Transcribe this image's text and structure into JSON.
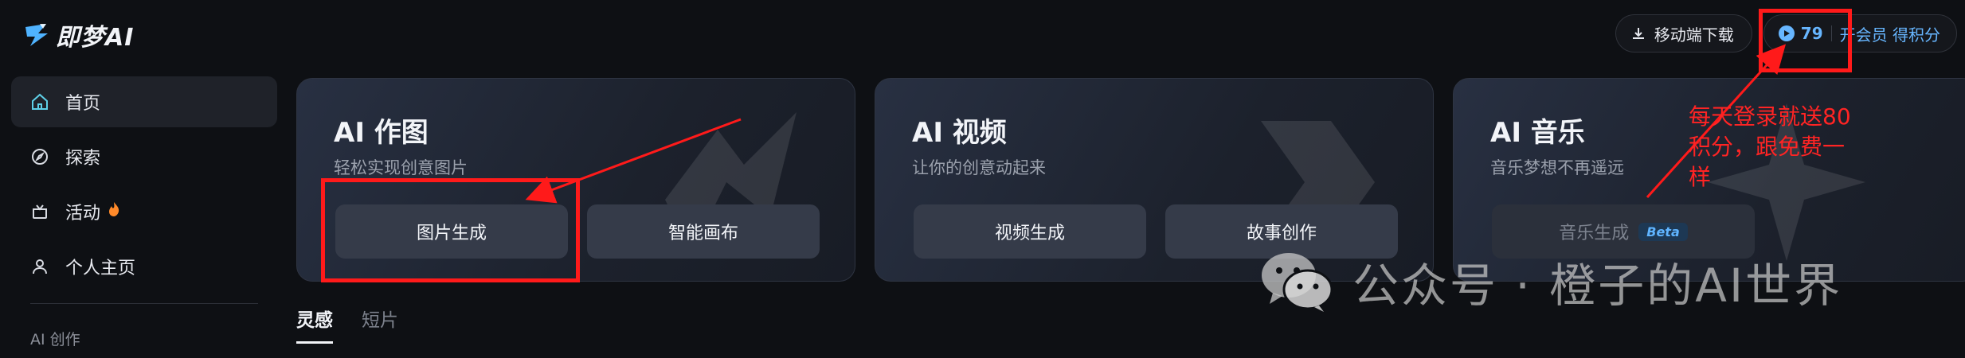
{
  "logo": {
    "text": "即梦AI",
    "icon": "lightning-star-logo-icon"
  },
  "sidebar": {
    "items": [
      {
        "label": "首页",
        "icon": "home-icon",
        "active": true
      },
      {
        "label": "探索",
        "icon": "compass-icon",
        "active": false
      },
      {
        "label": "活动",
        "icon": "gift-icon",
        "badge_icon": "fire-icon",
        "active": false
      },
      {
        "label": "个人主页",
        "icon": "user-icon",
        "active": false
      }
    ],
    "section_label": "AI 创作"
  },
  "header": {
    "download_label": "移动端下载",
    "download_icon": "download-icon",
    "points_value": "79",
    "points_icon": "points-coin-icon",
    "member_label": "开会员 得积分"
  },
  "cards": [
    {
      "title": "AI 作图",
      "subtitle": "轻松实现创意图片",
      "buttons": [
        "图片生成",
        "智能画布"
      ]
    },
    {
      "title": "AI 视频",
      "subtitle": "让你的创意动起来",
      "buttons": [
        "视频生成",
        "故事创作"
      ]
    },
    {
      "title": "AI 音乐",
      "subtitle": "音乐梦想不再遥远",
      "buttons": [
        "音乐生成"
      ],
      "badge": "Beta"
    }
  ],
  "tabs": [
    {
      "label": "灵感",
      "active": true
    },
    {
      "label": "短片",
      "active": false
    }
  ],
  "annotation": {
    "text": "每天登录就送80积分，跟免费一样",
    "color": "#ff1a1a"
  },
  "watermark": {
    "text": "公众号 · 橙子的AI世界",
    "icon": "wechat-icon"
  },
  "colors": {
    "background": "#0e1014",
    "accent_blue": "#67b6ff",
    "annotation_red": "#ff1a1a"
  }
}
